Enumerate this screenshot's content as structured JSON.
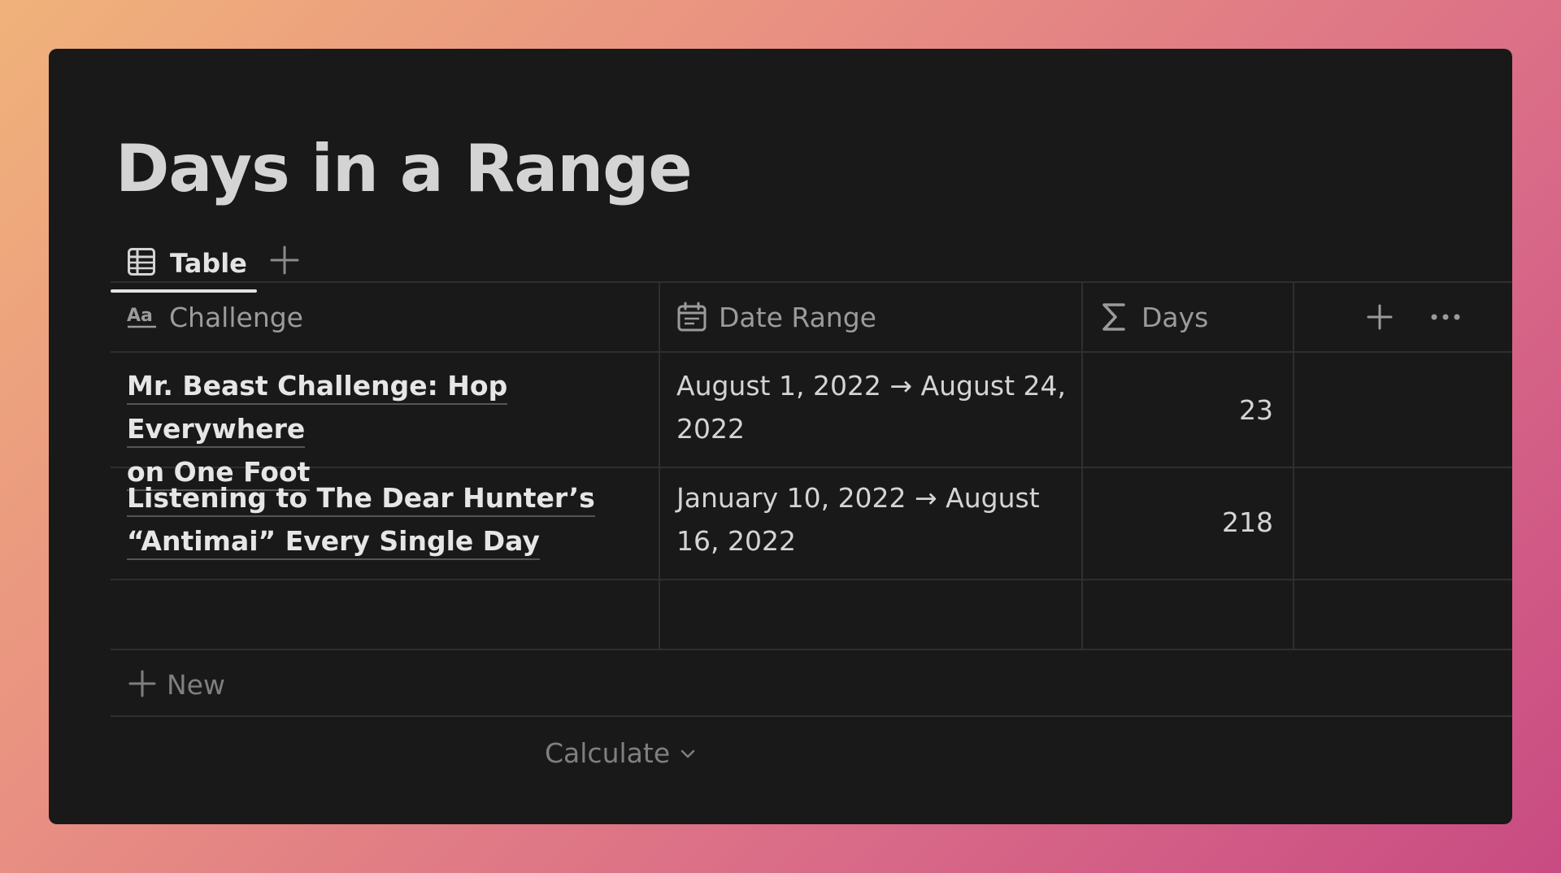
{
  "page": {
    "title": "Days in a Range"
  },
  "views": {
    "tabs": [
      {
        "label": "Table",
        "icon": "table-icon",
        "active": true
      }
    ],
    "add_view_icon": "plus-icon"
  },
  "table": {
    "columns": [
      {
        "label": "Challenge",
        "icon": "text-type-icon"
      },
      {
        "label": "Date Range",
        "icon": "calendar-icon"
      },
      {
        "label": "Days",
        "icon": "sigma-icon"
      }
    ],
    "header_actions": {
      "add_column_icon": "plus-icon",
      "more_icon": "ellipsis-icon"
    },
    "rows": [
      {
        "challenge_line1": "Mr. Beast Challenge: Hop Everywhere",
        "challenge_line2": "on One Foot",
        "date_line1": "August 1, 2022 → August 24,",
        "date_line2": "2022",
        "days": "23"
      },
      {
        "challenge_line1": "Listening to The Dear Hunter’s",
        "challenge_line2": "“Antimai” Every Single Day",
        "date_line1": "January 10, 2022 → August",
        "date_line2": "16, 2022",
        "days": "218"
      }
    ],
    "new_label": "New",
    "calculate_label": "Calculate"
  },
  "colors": {
    "window_bg": "#191919",
    "text_primary": "#d4d4d4",
    "text_muted": "#9b9b9b",
    "grid_line": "#2f2f2f"
  }
}
